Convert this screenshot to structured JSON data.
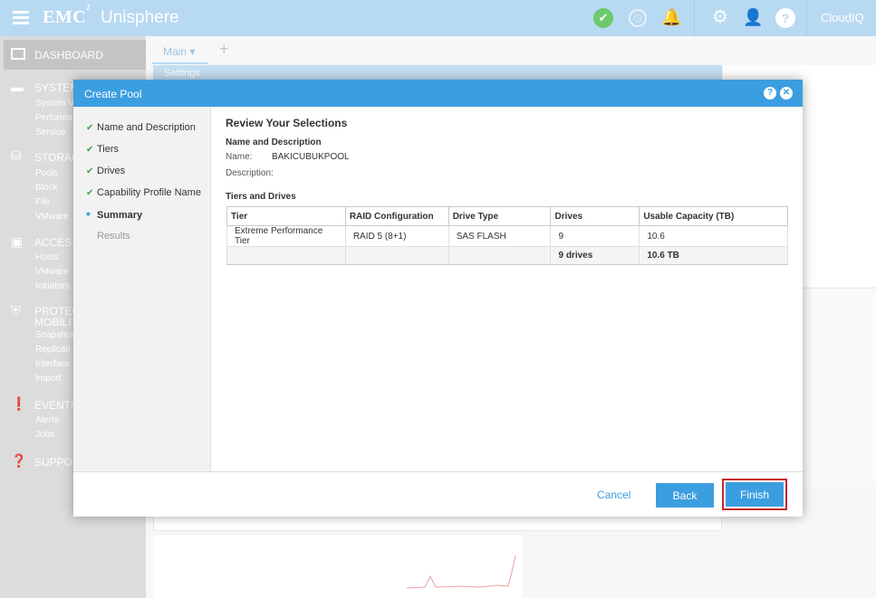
{
  "header": {
    "brand": "EMC",
    "brand_sup": "2",
    "app_name": "Unisphere",
    "cloudiq": "CloudIQ",
    "icons": [
      "menu-icon",
      "status-ok-icon",
      "jobs-clock-icon",
      "alerts-bell-icon",
      "settings-gear-icon",
      "user-icon",
      "help-icon",
      "cloudiq-icon"
    ]
  },
  "sidebar": {
    "dashboard": "DASHBOARD",
    "sections": [
      {
        "label": "SYSTEM",
        "items": [
          "System V",
          "Performa",
          "Service"
        ]
      },
      {
        "label": "STORAG",
        "items": [
          "Pools",
          "Block",
          "File",
          "VMware"
        ]
      },
      {
        "label": "ACCESS",
        "items": [
          "Hosts",
          "VMware",
          "Initiators"
        ]
      },
      {
        "label": "PROTEC",
        "label2": "MOBILIT",
        "items": [
          "Snapshot",
          "Replicati",
          "Interface",
          "Import"
        ]
      },
      {
        "label": "EVENTS",
        "items": [
          "Alerts",
          "Jobs"
        ]
      },
      {
        "label": "SUPPO",
        "items": []
      }
    ]
  },
  "main": {
    "tab": "Main",
    "tab_add": "+",
    "settings_label": "Settings"
  },
  "modal": {
    "title": "Create Pool",
    "steps": [
      {
        "label": "Name and Description",
        "state": "done"
      },
      {
        "label": "Tiers",
        "state": "done"
      },
      {
        "label": "Drives",
        "state": "done"
      },
      {
        "label": "Capability Profile Name",
        "state": "done"
      },
      {
        "label": "Summary",
        "state": "current"
      },
      {
        "label": "Results",
        "state": "pending"
      }
    ],
    "heading": "Review Your Selections",
    "name_desc_heading": "Name and Description",
    "name_key": "Name:",
    "name_value": "BAKICUBUKPOOL",
    "desc_key": "Description:",
    "desc_value": "",
    "tiers_heading": "Tiers and Drives",
    "table": {
      "columns": [
        "Tier",
        "RAID Configuration",
        "Drive Type",
        "Drives",
        "Usable Capacity (TB)"
      ],
      "rows": [
        [
          "Extreme Performance Tier",
          "RAID 5 (8+1)",
          "SAS FLASH",
          "9",
          "10.6"
        ]
      ],
      "totals": [
        "",
        "",
        "",
        "9 drives",
        "10.6 TB"
      ]
    },
    "buttons": {
      "cancel": "Cancel",
      "back": "Back",
      "finish": "Finish"
    }
  }
}
